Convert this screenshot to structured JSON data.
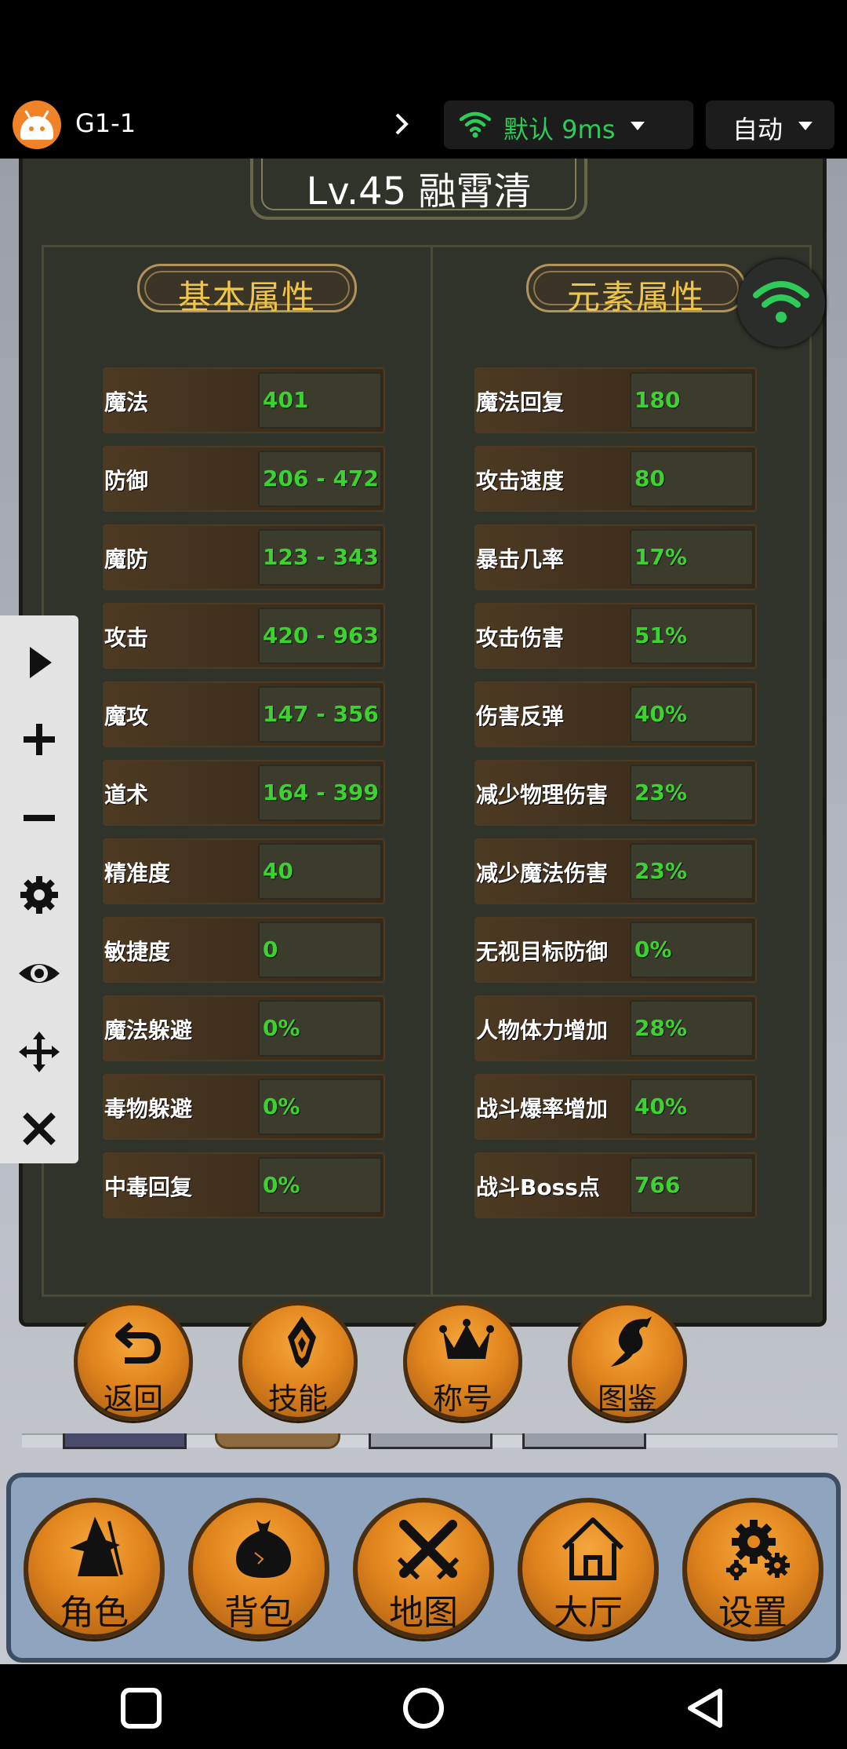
{
  "status_bar": {
    "app_title": "G1-1",
    "network_label": "默认 9ms",
    "mode_label": "自动"
  },
  "character": {
    "name_plate": "Lv.45 融霄清"
  },
  "sections": {
    "basic_title": "基本属性",
    "element_title": "元素属性"
  },
  "basic_attributes": [
    {
      "label": "魔法",
      "value": "401"
    },
    {
      "label": "防御",
      "value": "206 - 472"
    },
    {
      "label": "魔防",
      "value": "123 - 343"
    },
    {
      "label": "攻击",
      "value": "420 - 963"
    },
    {
      "label": "魔攻",
      "value": "147 - 356"
    },
    {
      "label": "道术",
      "value": "164 - 399"
    },
    {
      "label": "精准度",
      "value": "40"
    },
    {
      "label": "敏捷度",
      "value": "0"
    },
    {
      "label": "魔法躲避",
      "value": "0%"
    },
    {
      "label": "毒物躲避",
      "value": "0%"
    },
    {
      "label": "中毒回复",
      "value": "0%"
    }
  ],
  "element_attributes": [
    {
      "label": "魔法回复",
      "value": "180"
    },
    {
      "label": "攻击速度",
      "value": "80"
    },
    {
      "label": "暴击几率",
      "value": "17%"
    },
    {
      "label": "攻击伤害",
      "value": "51%"
    },
    {
      "label": "伤害反弹",
      "value": "40%"
    },
    {
      "label": "减少物理伤害",
      "value": "23%"
    },
    {
      "label": "减少魔法伤害",
      "value": "23%"
    },
    {
      "label": "无视目标防御",
      "value": "0%"
    },
    {
      "label": "人物体力增加",
      "value": "28%"
    },
    {
      "label": "战斗爆率增加",
      "value": "40%"
    },
    {
      "label": "战斗Boss点",
      "value": "766"
    }
  ],
  "action_buttons": {
    "back": "返回",
    "skills": "技能",
    "titles": "称号",
    "codex": "图鉴"
  },
  "bottom_nav": {
    "character": "角色",
    "bag": "背包",
    "map": "地图",
    "lobby": "大厅",
    "settings": "设置"
  },
  "icons": {
    "app": "android-icon",
    "network": "wifi-icon",
    "toolbar": [
      "play-icon",
      "plus-icon",
      "minus-icon",
      "gear-icon",
      "eye-icon",
      "move-icon",
      "close-icon"
    ]
  },
  "colors": {
    "value_green": "#3bd42f",
    "title_gold": "#f0c64a",
    "network_green": "#2fcb58",
    "button_orange": "#e2861e"
  }
}
